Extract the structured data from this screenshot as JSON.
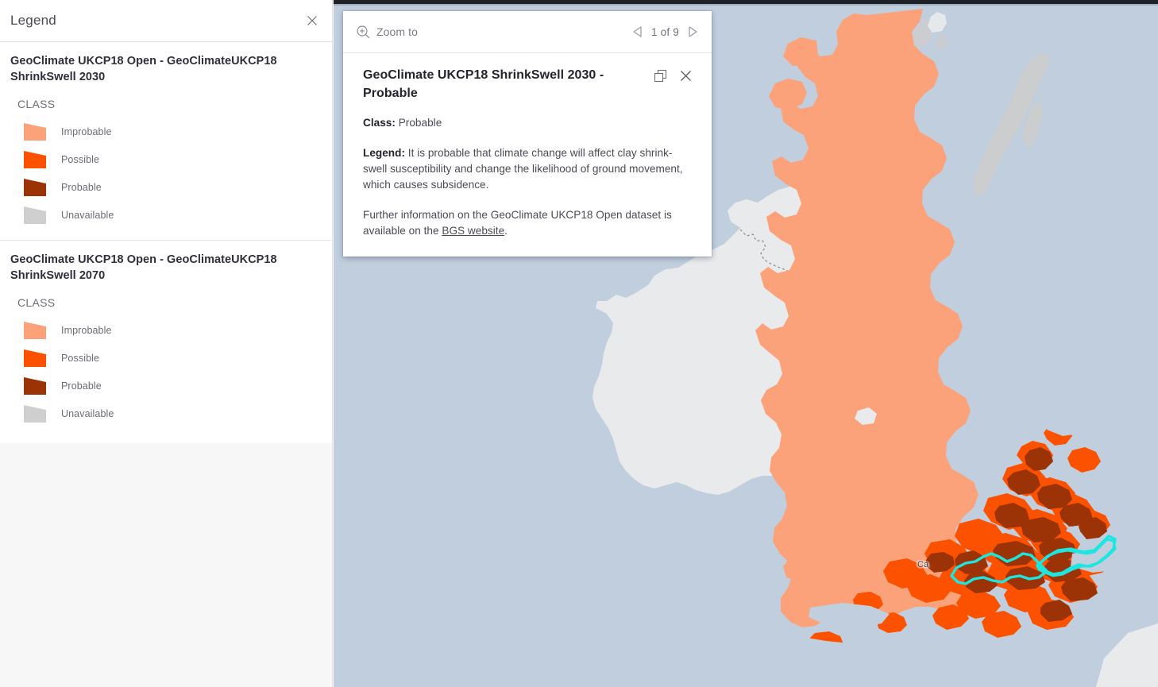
{
  "legend_panel": {
    "title": "Legend",
    "close_icon": "close-icon",
    "sections": [
      {
        "layer_title": "GeoClimate UKCP18 Open - GeoClimateUKCP18 ShrinkSwell 2030",
        "field_label": "CLASS",
        "items": [
          {
            "label": "Improbable",
            "color": "#fba27a"
          },
          {
            "label": "Possible",
            "color": "#fc5200"
          },
          {
            "label": "Probable",
            "color": "#9c3306"
          },
          {
            "label": "Unavailable",
            "color": "#cfcfcf"
          }
        ]
      },
      {
        "layer_title": "GeoClimate UKCP18 Open - GeoClimateUKCP18 ShrinkSwell 2070",
        "field_label": "CLASS",
        "items": [
          {
            "label": "Improbable",
            "color": "#fba27a"
          },
          {
            "label": "Possible",
            "color": "#fc5200"
          },
          {
            "label": "Probable",
            "color": "#9c3306"
          },
          {
            "label": "Unavailable",
            "color": "#cfcfcf"
          }
        ]
      }
    ]
  },
  "popup": {
    "toolbar": {
      "zoom_to_label": "Zoom to",
      "zoom_to_icon": "zoom-in-magnifier-icon",
      "prev_icon": "chevron-left-icon",
      "next_icon": "chevron-right-icon",
      "pagination": "1 of 9"
    },
    "title": "GeoClimate UKCP18 ShrinkSwell 2030 - Probable",
    "dock_icon": "windows-dock-icon",
    "close_icon": "close-icon",
    "fields": [
      {
        "label": "Class:",
        "value": " Probable"
      }
    ],
    "legend_label": "Legend:",
    "legend_text": " It is probable that climate change will affect clay shrink-swell susceptibility and change the likelihood of ground movement, which causes subsidence.",
    "further_info_pre": "Further information on the GeoClimate UKCP18 Open dataset is available on the ",
    "further_info_link": "BGS website",
    "further_info_post": "."
  },
  "map": {
    "city_label": "Ca",
    "colors": {
      "water": "#c0cede",
      "land_improbable": "#fba27a",
      "land_possible": "#fc5200",
      "land_probable": "#9c3306",
      "unavailable": "#e8eaec",
      "selection_outline": "#1de6e0"
    }
  }
}
